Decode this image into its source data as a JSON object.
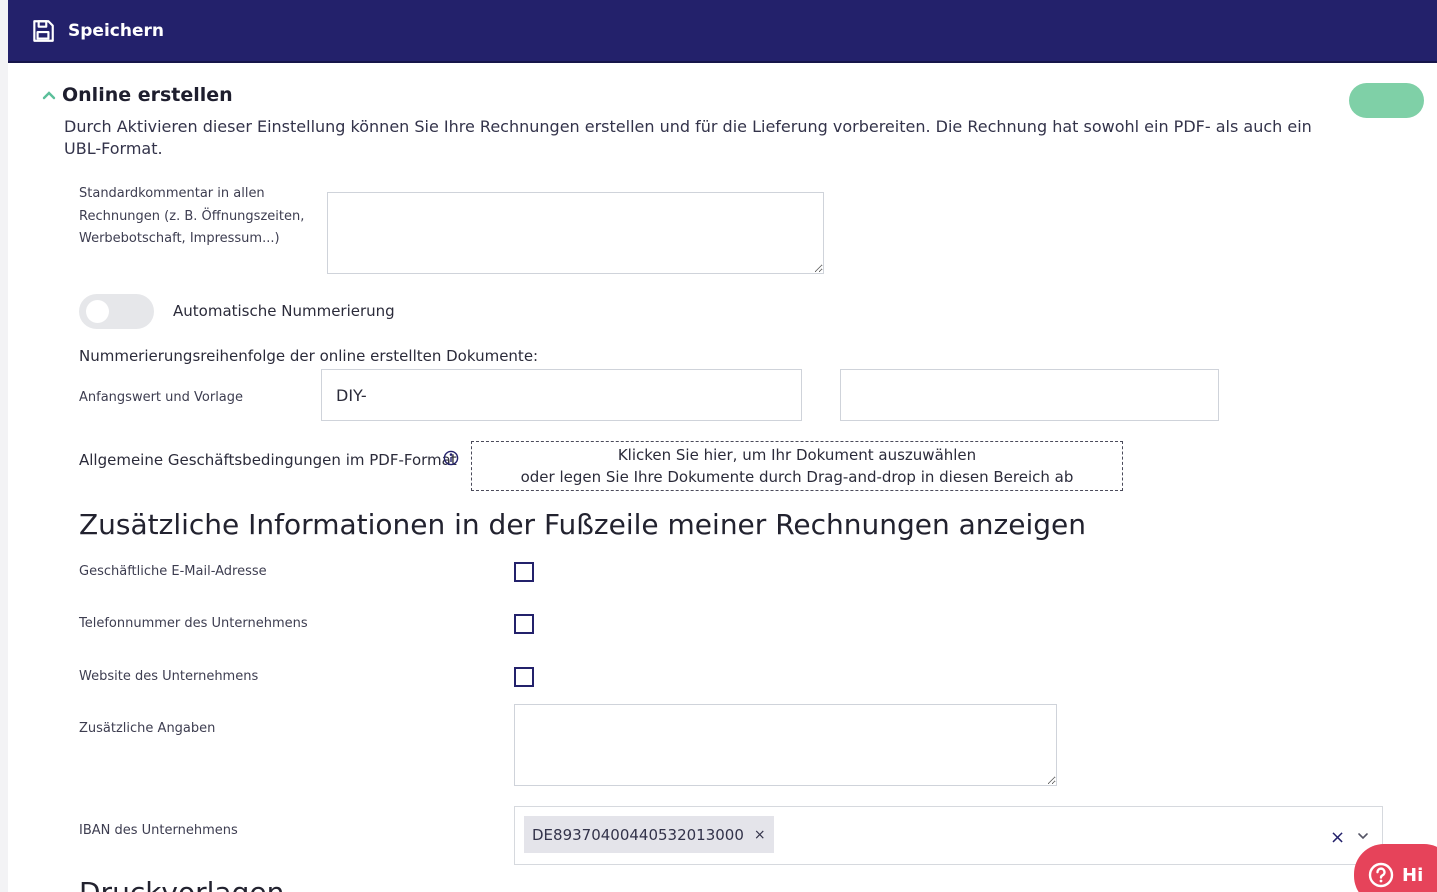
{
  "topbar": {
    "save_label": "Speichern",
    "save_icon": "floppy-disk-icon"
  },
  "section": {
    "title": "Online erstellen",
    "description": "Durch Aktivieren dieser Einstellung können Sie Ihre Rechnungen erstellen und für die Lieferung vorbereiten. Die Rechnung hat sowohl ein PDF- als auch ein UBL-Format.",
    "enabled_toggle_color": "#7fd0a7"
  },
  "form": {
    "comment_label": "Standardkommentar in allen Rechnungen (z. B. Öffnungszeiten, Werbebotschaft, Impressum...)",
    "comment_value": "",
    "auto_numbering_label": "Automatische Nummerierung",
    "numbering_heading": "Nummerierungsreihenfolge der online erstellten Dokumente:",
    "start_value_label": "Anfangswert und Vorlage",
    "prefix_value": "DIY-",
    "start_value": "",
    "terms_label": "Allgemeine Geschäftsbedingungen im PDF-Format",
    "dropzone_line1": "Klicken Sie hier, um Ihr Dokument auszuwählen",
    "dropzone_line2": "oder legen Sie Ihre Dokumente durch Drag-and-drop in diesen Bereich ab"
  },
  "footer_info": {
    "heading": "Zusätzliche Informationen in der Fußzeile meiner Rechnungen anzeigen",
    "email_label": "Geschäftliche E-Mail-Adresse",
    "phone_label": "Telefonnummer des Unternehmens",
    "website_label": "Website des Unternehmens",
    "extra_label": "Zusätzliche Angaben",
    "extra_value": "",
    "iban_label": "IBAN des Unternehmens",
    "iban_selected": "DE89370400440532013000",
    "chip_remove": "×",
    "clear_all": "×"
  },
  "cut_heading": "Druckvorlagen",
  "help": {
    "label": "Hi"
  },
  "colors": {
    "primary": "#23216b",
    "help": "#e6435a"
  }
}
